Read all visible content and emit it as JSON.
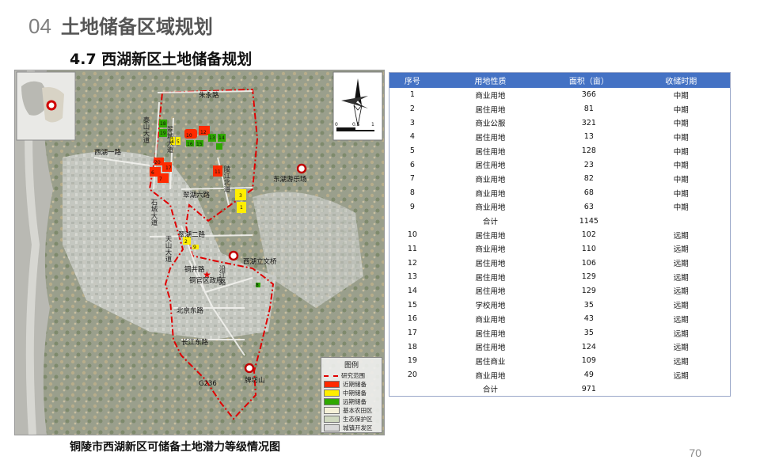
{
  "section": {
    "number": "04",
    "title": "土地储备区域规划"
  },
  "subtitle": "4.7 西湖新区土地储备规划",
  "map": {
    "caption": "铜陵市西湖新区可储备土地潜力等级情况图",
    "labels": {
      "zhuyong_road": "朱永路",
      "taishan_avenue": "泰山大道",
      "cuihu_city_avenue": "翠城大道",
      "xihu_1st_road": "西湖一路",
      "lingjiang_north_road": "陵江北道",
      "dongguhu_park": "东湖游乐场",
      "cuihu_6th_road": "翠湖六路",
      "shicheng_avenue": "石城大道",
      "cuihu_2nd_road": "翠湖二路",
      "tianshan_avenue": "天山大道",
      "xihu_culture_center": "西湖立文桥",
      "tongjing_road": "铜井路",
      "tongguan_gov": "铜官区政府",
      "yanjiang_road": "沿江路",
      "beijing_east_road": "北京东路",
      "changjiang_east_road": "长江东路",
      "g236": "G236",
      "paifangshan": "牌坊山",
      "parcels": [
        "18",
        "19",
        "20",
        "17",
        "10",
        "12",
        "13",
        "14",
        "15",
        "16",
        "11",
        "4",
        "5",
        "3",
        "1",
        "2",
        "9",
        "8",
        "6",
        "7"
      ]
    },
    "scale_labels": [
      "0",
      "0.5",
      "1"
    ],
    "legend": {
      "title": "图例",
      "items": [
        {
          "label": "研究范围",
          "color": "#e00000",
          "kind": "dash"
        },
        {
          "label": "近期储备",
          "color": "#ff2a00",
          "kind": "fill"
        },
        {
          "label": "中期储备",
          "color": "#ffee00",
          "kind": "fill"
        },
        {
          "label": "远期储备",
          "color": "#2fa800",
          "kind": "fill"
        },
        {
          "label": "基本农田区",
          "color": "#f5f1d8",
          "kind": "fill"
        },
        {
          "label": "生态保护区",
          "color": "#cfd8bf",
          "kind": "fill"
        },
        {
          "label": "城镇开发区",
          "color": "#d9d9d9",
          "kind": "fill"
        }
      ]
    }
  },
  "table": {
    "headers": [
      "序号",
      "用地性质",
      "面积（亩）",
      "收储时期"
    ],
    "rows_mid": [
      [
        "1",
        "商业用地",
        "366",
        "中期"
      ],
      [
        "2",
        "居住用地",
        "81",
        "中期"
      ],
      [
        "3",
        "商业公服",
        "321",
        "中期"
      ],
      [
        "4",
        "居住用地",
        "13",
        "中期"
      ],
      [
        "5",
        "居住用地",
        "128",
        "中期"
      ],
      [
        "6",
        "居住用地",
        "23",
        "中期"
      ],
      [
        "7",
        "商业用地",
        "82",
        "中期"
      ],
      [
        "8",
        "商业用地",
        "68",
        "中期"
      ],
      [
        "9",
        "商业用地",
        "63",
        "中期"
      ]
    ],
    "subtotal_mid": {
      "label": "合计",
      "value": "1145"
    },
    "rows_far": [
      [
        "10",
        "居住用地",
        "102",
        "远期"
      ],
      [
        "11",
        "商业用地",
        "110",
        "远期"
      ],
      [
        "12",
        "居住用地",
        "106",
        "远期"
      ],
      [
        "13",
        "居住用地",
        "129",
        "远期"
      ],
      [
        "14",
        "居住用地",
        "129",
        "远期"
      ],
      [
        "15",
        "学校用地",
        "35",
        "远期"
      ],
      [
        "16",
        "商业用地",
        "43",
        "远期"
      ],
      [
        "17",
        "居住用地",
        "35",
        "远期"
      ],
      [
        "18",
        "居住用地",
        "124",
        "远期"
      ],
      [
        "19",
        "居住商业",
        "109",
        "远期"
      ],
      [
        "20",
        "商业用地",
        "49",
        "远期"
      ]
    ],
    "subtotal_far": {
      "label": "合计",
      "value": "971"
    }
  },
  "page_number": "70"
}
